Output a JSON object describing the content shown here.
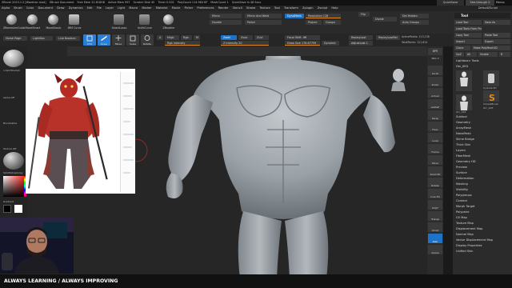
{
  "app": {
    "title_parts": [
      "ZBrush 2023.1.2 [Warehan mod]",
      "ZBrush Document",
      "Free Mem 22.818GB",
      "Active Mem 997",
      "Scratch Disk 45",
      "Timer 0.001",
      "PolyCount 114.964 KP",
      "MeshCount 1",
      "QuickSave In 48 Secs"
    ],
    "quicksave": "QuickSave",
    "seethrough": "See-through 0",
    "menus_label": "Menus",
    "default_script": "DefaultZScript"
  },
  "menubar": [
    "Alpha",
    "Brush",
    "Color",
    "Document",
    "Draw",
    "Dynamics",
    "Edit",
    "File",
    "Layer",
    "Light",
    "Macro",
    "Marker",
    "Material",
    "Movie",
    "Picker",
    "Preferences",
    "Render",
    "Stencil",
    "Stroke",
    "Texture",
    "Tool",
    "Transform",
    "Zplugin",
    "Zscript",
    "Help"
  ],
  "shelf": {
    "brushes": [
      {
        "label": "ZRemesherGuide"
      },
      {
        "label": "MoveSmart"
      },
      {
        "label": "MoveElastic"
      },
      {
        "label": "IMM Curve"
      },
      {
        "label": "SelectLasso"
      },
      {
        "label": "KnifeCurve"
      },
      {
        "label": "ZModeler"
      }
    ],
    "buttons": {
      "mirror": "Mirror",
      "mirror_weld": "Mirror And Weld",
      "double": "Double",
      "polish": "Polish",
      "dynamesh": "DynaMesh",
      "resolution": "Resolution 128",
      "project": "Project",
      "groups": "Groups",
      "divide": "Divide",
      "del_hidden": "Del Hidden",
      "auto_groups": "Auto Groups",
      "flip": "Flip",
      "dot_label": "Dot Hidden"
    }
  },
  "shelf2": {
    "home_page": "Home Page",
    "lightbox": "LightBox",
    "live_boolean": "Live Boolean",
    "tools": [
      "Edit",
      "Draw",
      "Move",
      "Scale",
      "Rotate"
    ],
    "mrgb": "Mrgb",
    "rgb": "Rgb",
    "m": "M",
    "zadd": "Zadd",
    "zsub": "Zsub",
    "zcut": "Zcut",
    "focal_shift_label": "Focal Shift",
    "focal_shift_value": "-96",
    "draw_size_label": "Draw Size",
    "draw_size_value": "176.67799",
    "dynamic": "Dynamic",
    "rgb_intensity": "Rgb Intensity",
    "z_intensity_label": "Z Intensity",
    "z_intensity_value": "20",
    "replay_last": "ReplayLast",
    "replay_last_rel": "ReplayLastRel",
    "active_points": "ActivePoints: 113,138",
    "total_points": "TotalPoints: 121,814",
    "adjust_last": "AdjustLast 1"
  },
  "left_tray": {
    "material_label": "1-SkinShade4",
    "alpha_label": "Alpha Off",
    "texture_label": "Texture Off",
    "brush_label": "BrushAlpha",
    "matcap_label": "SkinMatcapGray",
    "gradient_label": "Gradient",
    "switch_color": "SwitchColor",
    "alternate": "Alternate"
  },
  "right_palette": {
    "header": "Tool",
    "load_tool": "Load Tool",
    "save_as": "Save As",
    "copy_tool": "Copy Tool",
    "paste_tool": "Paste Tool",
    "import": "Import",
    "export": "Export",
    "clone": "Clone",
    "make_polymesh": "Make PolyMesh3D",
    "goz": "GoZ",
    "all": "All",
    "visible": "Visible",
    "r": "R",
    "lightbox_tools": "Lightbox> Tools",
    "current_tool": "Orc_003",
    "cyl_label": "Cylinder3D",
    "simple_brush": "SimpleBrush",
    "orc_a": "Orc_003",
    "orc_b": "Orc_003",
    "sections": [
      "Subtool",
      "Geometry",
      "ArrayMesh",
      "NanoMesh",
      "Slime Bridge",
      "Thick Skin",
      "Layers",
      "FiberMesh",
      "Geometry HD",
      "Preview",
      "Surface",
      "Deformation",
      "Masking",
      "Visibility",
      "Polygroups",
      "Contact",
      "Morph Target",
      "Polypaint",
      "UV Map",
      "Texture Map",
      "Displacement Map",
      "Normal Map",
      "Vector Displacement Map",
      "Display Properties",
      "Unified Skin"
    ]
  },
  "right_narrow": [
    "BPR",
    "SPix 3",
    "Scroll",
    "Zoom",
    "Actual",
    "AAHalf",
    "Persp",
    "Floor",
    "Local",
    "Frame",
    "Move",
    "Zoom3D",
    "Rotate",
    "Line Fill",
    "PolyF",
    "Transp",
    "Ghost",
    "Solo",
    "Xpose"
  ],
  "banner": {
    "text": "ALWAYS LEARNING  /  ALWAYS IMPROVING"
  },
  "colors": {
    "accent_blue": "#1d73c8",
    "accent_orange": "#e08a1a",
    "canvas_bg": "#262626",
    "sculpt": "#a7adb3"
  }
}
